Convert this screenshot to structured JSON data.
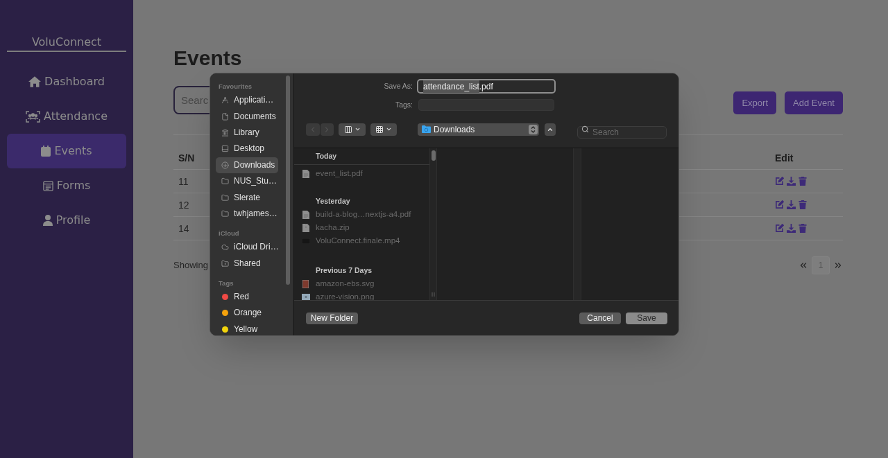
{
  "sidebar": {
    "brand": "VoluConnect",
    "items": [
      {
        "label": "Dashboard",
        "kind": "home",
        "selected": false
      },
      {
        "label": "Attendance",
        "kind": "attendance",
        "selected": false
      },
      {
        "label": "Events",
        "kind": "calendar",
        "selected": true
      },
      {
        "label": "Forms",
        "kind": "form",
        "selected": false
      },
      {
        "label": "Profile",
        "kind": "profile",
        "selected": false
      }
    ]
  },
  "main": {
    "title": "Events",
    "search": {
      "placeholder": "Searc"
    },
    "buttons": [
      "Export",
      "Add Event"
    ],
    "table": {
      "columns": [
        "S/N",
        "Edit"
      ],
      "rows": [
        {
          "sn": "11"
        },
        {
          "sn": "12"
        },
        {
          "sn": "14"
        }
      ]
    },
    "footer_text": "Showing",
    "pagination": {
      "pages": [
        {
          "label": "1",
          "selected": true
        }
      ]
    }
  },
  "save_dialog": {
    "sidebar": {
      "sections": [
        {
          "title": "Favourites",
          "items": [
            {
              "label": "Applicati…",
              "kind": "apps",
              "selected": false
            },
            {
              "label": "Documents",
              "kind": "document",
              "selected": false
            },
            {
              "label": "Library",
              "kind": "library",
              "selected": false
            },
            {
              "label": "Desktop",
              "kind": "desktop",
              "selected": false
            },
            {
              "label": "Downloads",
              "kind": "downloads",
              "selected": true
            },
            {
              "label": "NUS_Stu…",
              "kind": "folder",
              "selected": false
            },
            {
              "label": "Slerate",
              "kind": "folder",
              "selected": false
            },
            {
              "label": "twhjames…",
              "kind": "folder",
              "selected": false
            }
          ]
        },
        {
          "title": "iCloud",
          "items": [
            {
              "label": "iCloud Dri…",
              "kind": "cloud",
              "selected": false
            },
            {
              "label": "Shared",
              "kind": "shared",
              "selected": false
            }
          ]
        },
        {
          "title": "Tags",
          "items": [
            {
              "label": "Red",
              "kind": "tag",
              "color": "#f04a45",
              "selected": false
            },
            {
              "label": "Orange",
              "kind": "tag",
              "color": "#f5a20c",
              "selected": false
            },
            {
              "label": "Yellow",
              "kind": "tag",
              "color": "#f2d40c",
              "selected": false
            }
          ]
        }
      ]
    },
    "save_as": {
      "label": "Save As:",
      "selected_part": "attendance_list",
      "rest": ".pdf"
    },
    "tags_field": {
      "label": "Tags:"
    },
    "toolbar": {
      "back": {
        "disabled": true
      },
      "forward": {
        "disabled": true
      },
      "location": "Downloads",
      "search": {
        "placeholder": "Search"
      }
    },
    "browser": {
      "sections": [
        {
          "title": "Today",
          "items": [
            {
              "name": "event_list.pdf",
              "kind": "pdf",
              "disabled": true
            }
          ]
        },
        {
          "title": "Yesterday",
          "items": [
            {
              "name": "build-a-blog…nextjs-a4.pdf",
              "kind": "pdf",
              "disabled": true
            },
            {
              "name": "kacha.zip",
              "kind": "zip",
              "disabled": true
            },
            {
              "name": "VoluConnect.finale.mp4",
              "kind": "video",
              "disabled": true
            }
          ]
        },
        {
          "title": "Previous 7 Days",
          "items": [
            {
              "name": "amazon-ebs.svg",
              "kind": "svg",
              "disabled": true
            },
            {
              "name": "azure-vision.png",
              "kind": "png",
              "disabled": true
            }
          ]
        }
      ]
    },
    "buttons": {
      "new_folder": "New Folder",
      "cancel": "Cancel",
      "save": "Save"
    }
  }
}
